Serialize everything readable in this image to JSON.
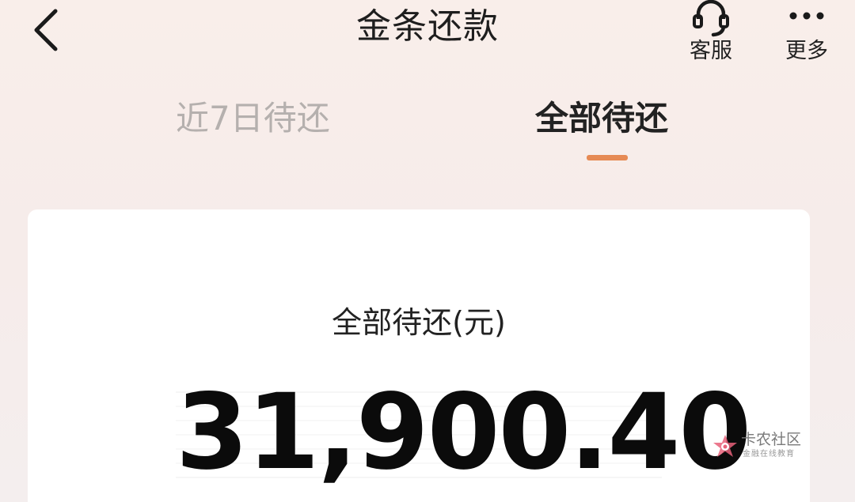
{
  "header": {
    "title": "金条还款",
    "service_label": "客服",
    "more_label": "更多"
  },
  "tabs": [
    {
      "label": "近7日待还",
      "active": false
    },
    {
      "label": "全部待还",
      "active": true
    }
  ],
  "card": {
    "label": "全部待还(元)",
    "amount": "31,900.40"
  },
  "watermark": {
    "title": "卡农社区",
    "subtitle": "金融在线教育"
  },
  "colors": {
    "accent": "#e68a54",
    "inactive_tab": "#b5b0ae",
    "text": "#222222",
    "card_bg": "#ffffff"
  },
  "icons": {
    "back": "chevron-left-icon",
    "service": "headset-icon",
    "more": "ellipsis-icon"
  }
}
